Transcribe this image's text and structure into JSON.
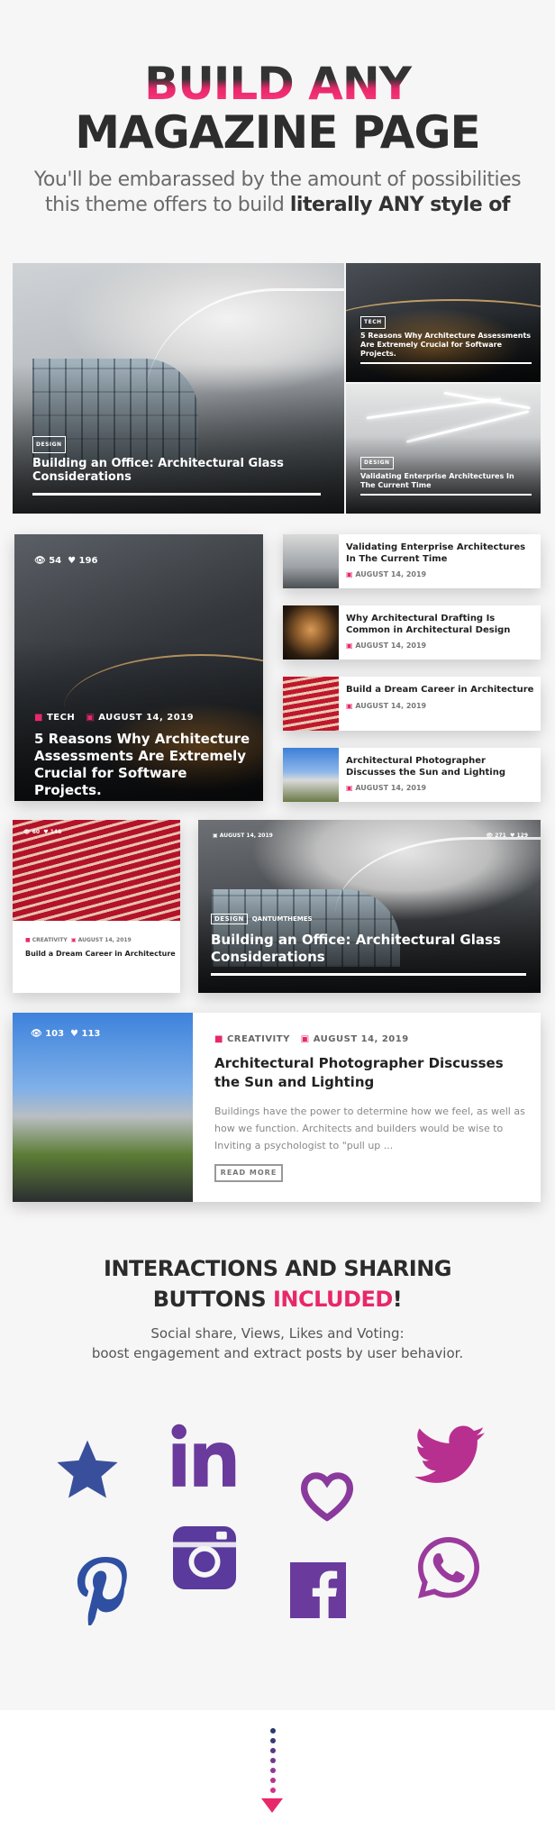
{
  "hero": {
    "line1": "BUILD ANY",
    "line2": "MAGAZINE PAGE",
    "sub_line1": "You'll be embarassed by the amount of possibilities",
    "sub_line2_plain": "this theme offers to build ",
    "sub_line2_bold": "literally ANY style of"
  },
  "mosaic": {
    "main": {
      "cat": "DESIGN",
      "title": "Building an Office: Architectural Glass Considerations"
    },
    "top_right": {
      "cat": "TECH",
      "title": "5 Reasons Why Architecture Assessments Are Extremely Crucial for Software Projects."
    },
    "bottom_right": {
      "cat": "DESIGN",
      "title": "Validating Enterprise Architectures In The Current Time"
    }
  },
  "featured": {
    "views": "54",
    "likes": "196",
    "cat": "TECH",
    "date": "AUGUST 14, 2019",
    "title": "5 Reasons Why Architecture Assessments Are Extremely Crucial for Software Projects."
  },
  "list": [
    {
      "title": "Validating Enterprise Architectures In The Current Time",
      "date": "AUGUST 14, 2019"
    },
    {
      "title": "Why Architectural Drafting Is Common in Architectural Design",
      "date": "AUGUST 14, 2019"
    },
    {
      "title": "Build a Dream Career in Architecture",
      "date": "AUGUST 14, 2019"
    },
    {
      "title": "Architectural Photographer Discusses the Sun and Lighting",
      "date": "AUGUST 14, 2019"
    }
  ],
  "small_card": {
    "views": "60",
    "likes": "148",
    "cat": "CREATIVITY",
    "date": "AUGUST 14, 2019",
    "title": "Build a Dream Career in Architecture"
  },
  "wide_card": {
    "date": "AUGUST 14, 2019",
    "views": "271",
    "likes": "129",
    "cat": "DESIGN",
    "author": "QANTUMTHEMES",
    "title": "Building an Office: Architectural Glass Considerations"
  },
  "horizontal_card": {
    "views": "103",
    "likes": "113",
    "cat": "CREATIVITY",
    "date": "AUGUST 14, 2019",
    "title": "Architectural Photographer Discusses the Sun and Lighting",
    "excerpt": "Buildings have the power to determine how we feel, as well as how we function. Architects and builders would be wise to Inviting a psychologist to \"pull up ...",
    "button": "READ MORE"
  },
  "interactions": {
    "line1": "INTERACTIONS AND SHARING",
    "line2_plain": "BUTTONS ",
    "line2_accent": "INCLUDED",
    "line2_end": "!",
    "sub1": "Social share, Views, Likes and Voting:",
    "sub2": "boost engagement and extract posts by user behavior."
  },
  "colors": {
    "accent": "#e8286a",
    "icon_blue": "#3a4f9c",
    "icon_purple": "#7a3a9c",
    "icon_magenta": "#b8308f"
  }
}
